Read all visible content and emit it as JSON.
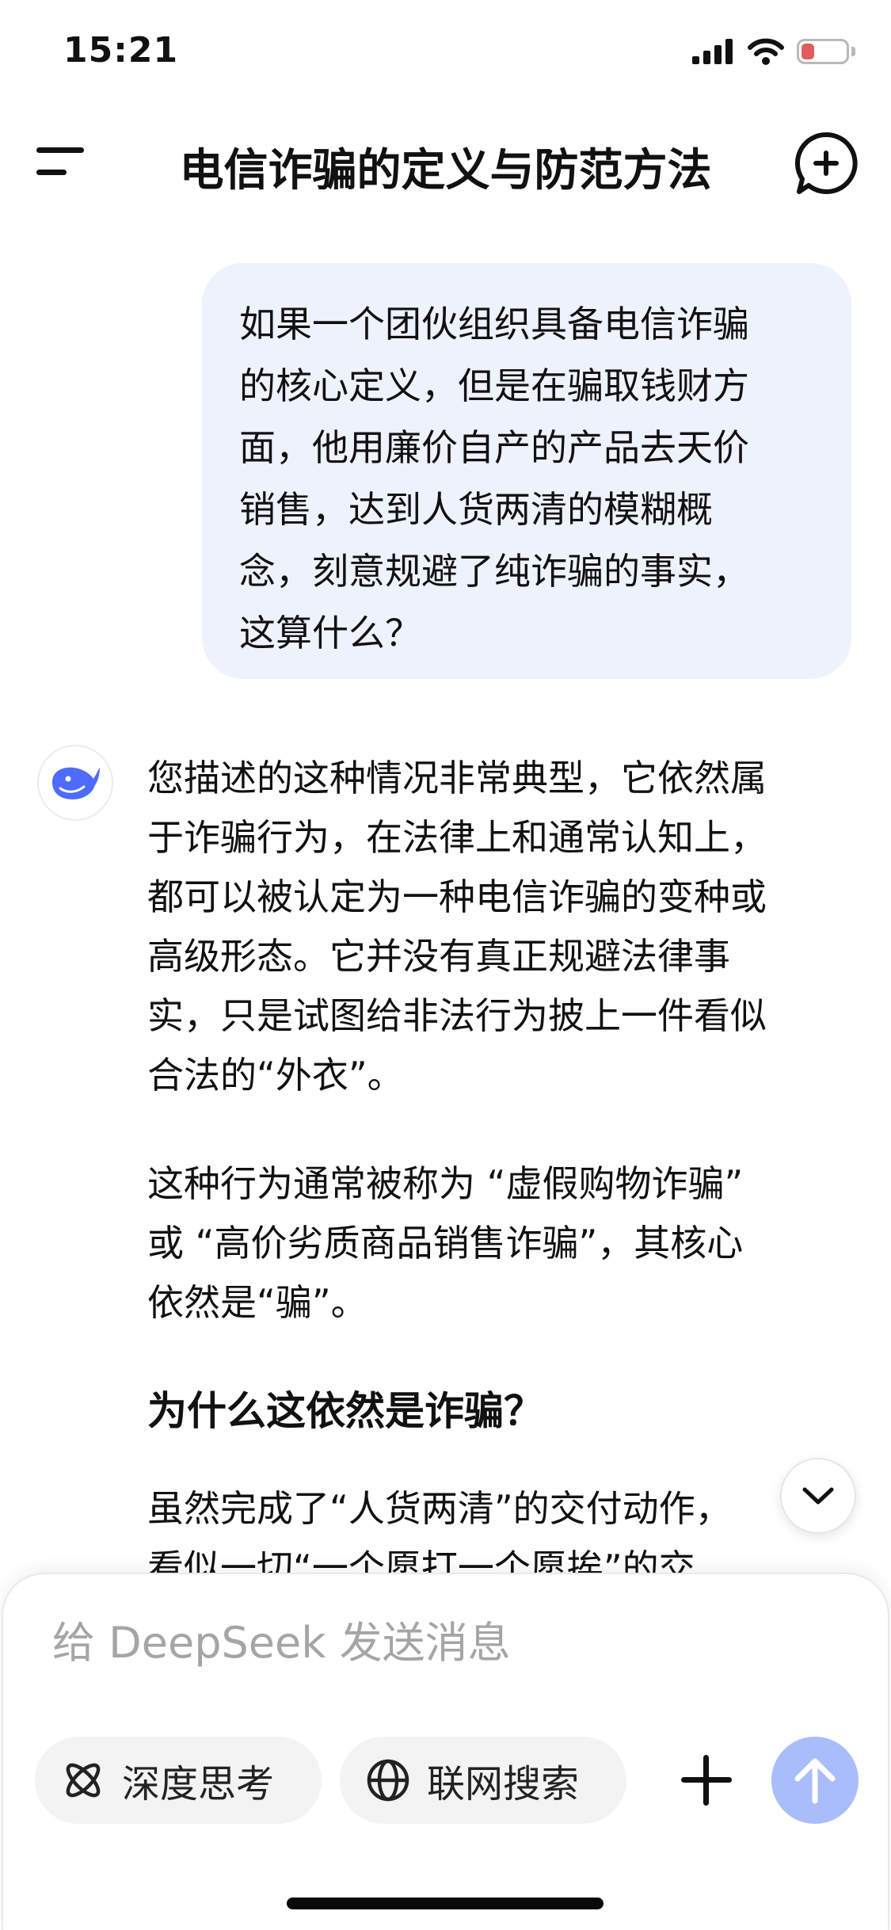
{
  "status_bar": {
    "time": "15:21",
    "battery_label": "7"
  },
  "header": {
    "title": "电信诈骗的定义与防范方法"
  },
  "user_message": {
    "lines": [
      "如果一个团伙组织具备电信诈骗",
      "的核心定义，但是在骗取钱财方",
      "面，他用廉价自产的产品去天价",
      "销售，达到人货两清的模糊概",
      "念，刻意规避了纯诈骗的事实，",
      "这算什么？"
    ]
  },
  "assistant_message": {
    "para1_lines": [
      "您描述的这种情况非常典型，它依然属",
      "于诈骗行为，在法律上和通常认知上，",
      "都可以被认定为一种电信诈骗的变种或",
      "高级形态。它并没有真正规避法律事",
      "实，只是试图给非法行为披上一件看似",
      "合法的“外衣”。"
    ],
    "para2_lines": [
      "这种行为通常被称为 “虚假购物诈骗”",
      "或 “高价劣质商品销售诈骗”，其核心",
      "依然是“骗”。"
    ],
    "heading": "为什么这依然是诈骗？",
    "para3_lines": [
      "虽然完成了“人货两清”的交付动作，",
      "看似一切“一个愿打一个愿挨”的交"
    ]
  },
  "composer": {
    "placeholder": "给 DeepSeek 发送消息",
    "deep_think_label": "深度思考",
    "web_search_label": "联网搜索"
  },
  "colors": {
    "user_bubble_bg": "#edf2fd",
    "send_button": "#a9bdfa",
    "brand_blue": "#4d6bfe"
  }
}
